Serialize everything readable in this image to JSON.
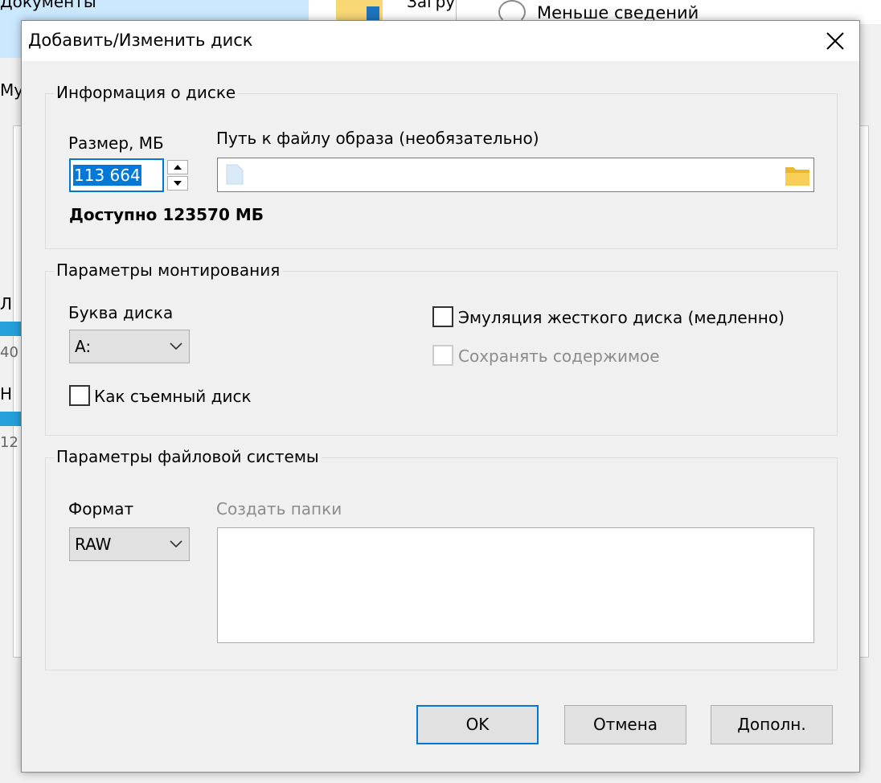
{
  "background_window": {
    "documents_label": "Документы",
    "downloads_label": "Загру",
    "less_details_label": "Меньше сведений",
    "side_my": "Му",
    "side_l": "Л",
    "side_40": "40",
    "side_h": "Н",
    "side_12": "12",
    "accent_color": "#26a0da"
  },
  "dialog": {
    "title": "Добавить/Изменить диск",
    "disk_info": {
      "group_label": "Информация о диске",
      "size_label": "Размер, МБ",
      "size_value": "113 664",
      "path_label": "Путь к файлу образа (необязательно)",
      "path_value": "",
      "available_text": "Доступно 123570 МБ"
    },
    "mount": {
      "group_label": "Параметры монтирования",
      "drive_letter_label": "Буква диска",
      "drive_letter_value": "A:",
      "removable_label": "Как съемный диск",
      "removable_checked": false,
      "hdd_emulation_label": "Эмуляция жесткого диска (медленно)",
      "hdd_emulation_checked": false,
      "keep_contents_label": "Сохранять содержимое",
      "keep_contents_checked": false,
      "keep_contents_enabled": false
    },
    "filesystem": {
      "group_label": "Параметры файловой системы",
      "format_label": "Формат",
      "format_value": "RAW",
      "create_folders_label": "Создать папки",
      "create_folders_value": ""
    },
    "buttons": {
      "ok": "OK",
      "cancel": "Отмена",
      "advanced": "Дополн."
    },
    "colors": {
      "focus_accent": "#0078d7",
      "button_face": "#e1e1e1",
      "dialog_bg": "#f0f0f0"
    }
  }
}
